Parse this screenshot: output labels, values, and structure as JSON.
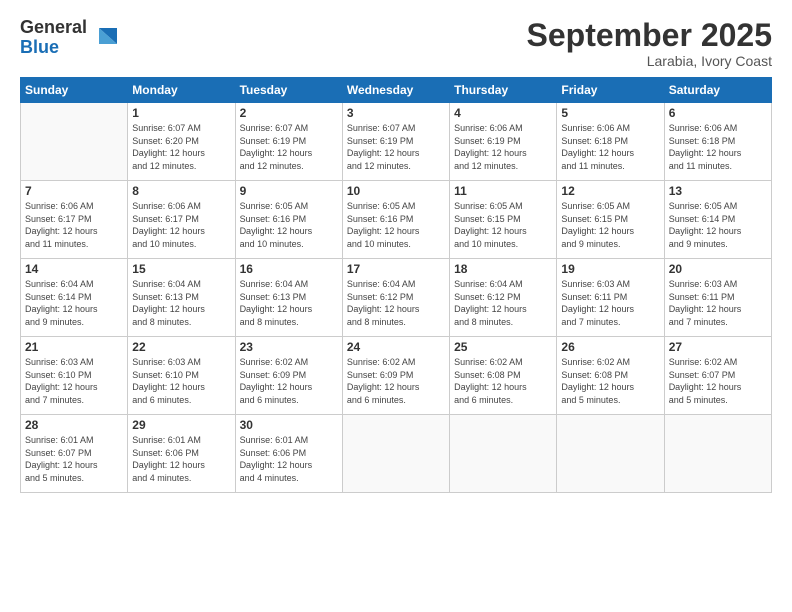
{
  "logo": {
    "general": "General",
    "blue": "Blue"
  },
  "header": {
    "month": "September 2025",
    "location": "Larabia, Ivory Coast"
  },
  "weekdays": [
    "Sunday",
    "Monday",
    "Tuesday",
    "Wednesday",
    "Thursday",
    "Friday",
    "Saturday"
  ],
  "weeks": [
    [
      {
        "day": "",
        "info": ""
      },
      {
        "day": "1",
        "info": "Sunrise: 6:07 AM\nSunset: 6:20 PM\nDaylight: 12 hours\nand 12 minutes."
      },
      {
        "day": "2",
        "info": "Sunrise: 6:07 AM\nSunset: 6:19 PM\nDaylight: 12 hours\nand 12 minutes."
      },
      {
        "day": "3",
        "info": "Sunrise: 6:07 AM\nSunset: 6:19 PM\nDaylight: 12 hours\nand 12 minutes."
      },
      {
        "day": "4",
        "info": "Sunrise: 6:06 AM\nSunset: 6:19 PM\nDaylight: 12 hours\nand 12 minutes."
      },
      {
        "day": "5",
        "info": "Sunrise: 6:06 AM\nSunset: 6:18 PM\nDaylight: 12 hours\nand 11 minutes."
      },
      {
        "day": "6",
        "info": "Sunrise: 6:06 AM\nSunset: 6:18 PM\nDaylight: 12 hours\nand 11 minutes."
      }
    ],
    [
      {
        "day": "7",
        "info": "Sunrise: 6:06 AM\nSunset: 6:17 PM\nDaylight: 12 hours\nand 11 minutes."
      },
      {
        "day": "8",
        "info": "Sunrise: 6:06 AM\nSunset: 6:17 PM\nDaylight: 12 hours\nand 10 minutes."
      },
      {
        "day": "9",
        "info": "Sunrise: 6:05 AM\nSunset: 6:16 PM\nDaylight: 12 hours\nand 10 minutes."
      },
      {
        "day": "10",
        "info": "Sunrise: 6:05 AM\nSunset: 6:16 PM\nDaylight: 12 hours\nand 10 minutes."
      },
      {
        "day": "11",
        "info": "Sunrise: 6:05 AM\nSunset: 6:15 PM\nDaylight: 12 hours\nand 10 minutes."
      },
      {
        "day": "12",
        "info": "Sunrise: 6:05 AM\nSunset: 6:15 PM\nDaylight: 12 hours\nand 9 minutes."
      },
      {
        "day": "13",
        "info": "Sunrise: 6:05 AM\nSunset: 6:14 PM\nDaylight: 12 hours\nand 9 minutes."
      }
    ],
    [
      {
        "day": "14",
        "info": "Sunrise: 6:04 AM\nSunset: 6:14 PM\nDaylight: 12 hours\nand 9 minutes."
      },
      {
        "day": "15",
        "info": "Sunrise: 6:04 AM\nSunset: 6:13 PM\nDaylight: 12 hours\nand 8 minutes."
      },
      {
        "day": "16",
        "info": "Sunrise: 6:04 AM\nSunset: 6:13 PM\nDaylight: 12 hours\nand 8 minutes."
      },
      {
        "day": "17",
        "info": "Sunrise: 6:04 AM\nSunset: 6:12 PM\nDaylight: 12 hours\nand 8 minutes."
      },
      {
        "day": "18",
        "info": "Sunrise: 6:04 AM\nSunset: 6:12 PM\nDaylight: 12 hours\nand 8 minutes."
      },
      {
        "day": "19",
        "info": "Sunrise: 6:03 AM\nSunset: 6:11 PM\nDaylight: 12 hours\nand 7 minutes."
      },
      {
        "day": "20",
        "info": "Sunrise: 6:03 AM\nSunset: 6:11 PM\nDaylight: 12 hours\nand 7 minutes."
      }
    ],
    [
      {
        "day": "21",
        "info": "Sunrise: 6:03 AM\nSunset: 6:10 PM\nDaylight: 12 hours\nand 7 minutes."
      },
      {
        "day": "22",
        "info": "Sunrise: 6:03 AM\nSunset: 6:10 PM\nDaylight: 12 hours\nand 6 minutes."
      },
      {
        "day": "23",
        "info": "Sunrise: 6:02 AM\nSunset: 6:09 PM\nDaylight: 12 hours\nand 6 minutes."
      },
      {
        "day": "24",
        "info": "Sunrise: 6:02 AM\nSunset: 6:09 PM\nDaylight: 12 hours\nand 6 minutes."
      },
      {
        "day": "25",
        "info": "Sunrise: 6:02 AM\nSunset: 6:08 PM\nDaylight: 12 hours\nand 6 minutes."
      },
      {
        "day": "26",
        "info": "Sunrise: 6:02 AM\nSunset: 6:08 PM\nDaylight: 12 hours\nand 5 minutes."
      },
      {
        "day": "27",
        "info": "Sunrise: 6:02 AM\nSunset: 6:07 PM\nDaylight: 12 hours\nand 5 minutes."
      }
    ],
    [
      {
        "day": "28",
        "info": "Sunrise: 6:01 AM\nSunset: 6:07 PM\nDaylight: 12 hours\nand 5 minutes."
      },
      {
        "day": "29",
        "info": "Sunrise: 6:01 AM\nSunset: 6:06 PM\nDaylight: 12 hours\nand 4 minutes."
      },
      {
        "day": "30",
        "info": "Sunrise: 6:01 AM\nSunset: 6:06 PM\nDaylight: 12 hours\nand 4 minutes."
      },
      {
        "day": "",
        "info": ""
      },
      {
        "day": "",
        "info": ""
      },
      {
        "day": "",
        "info": ""
      },
      {
        "day": "",
        "info": ""
      }
    ]
  ]
}
